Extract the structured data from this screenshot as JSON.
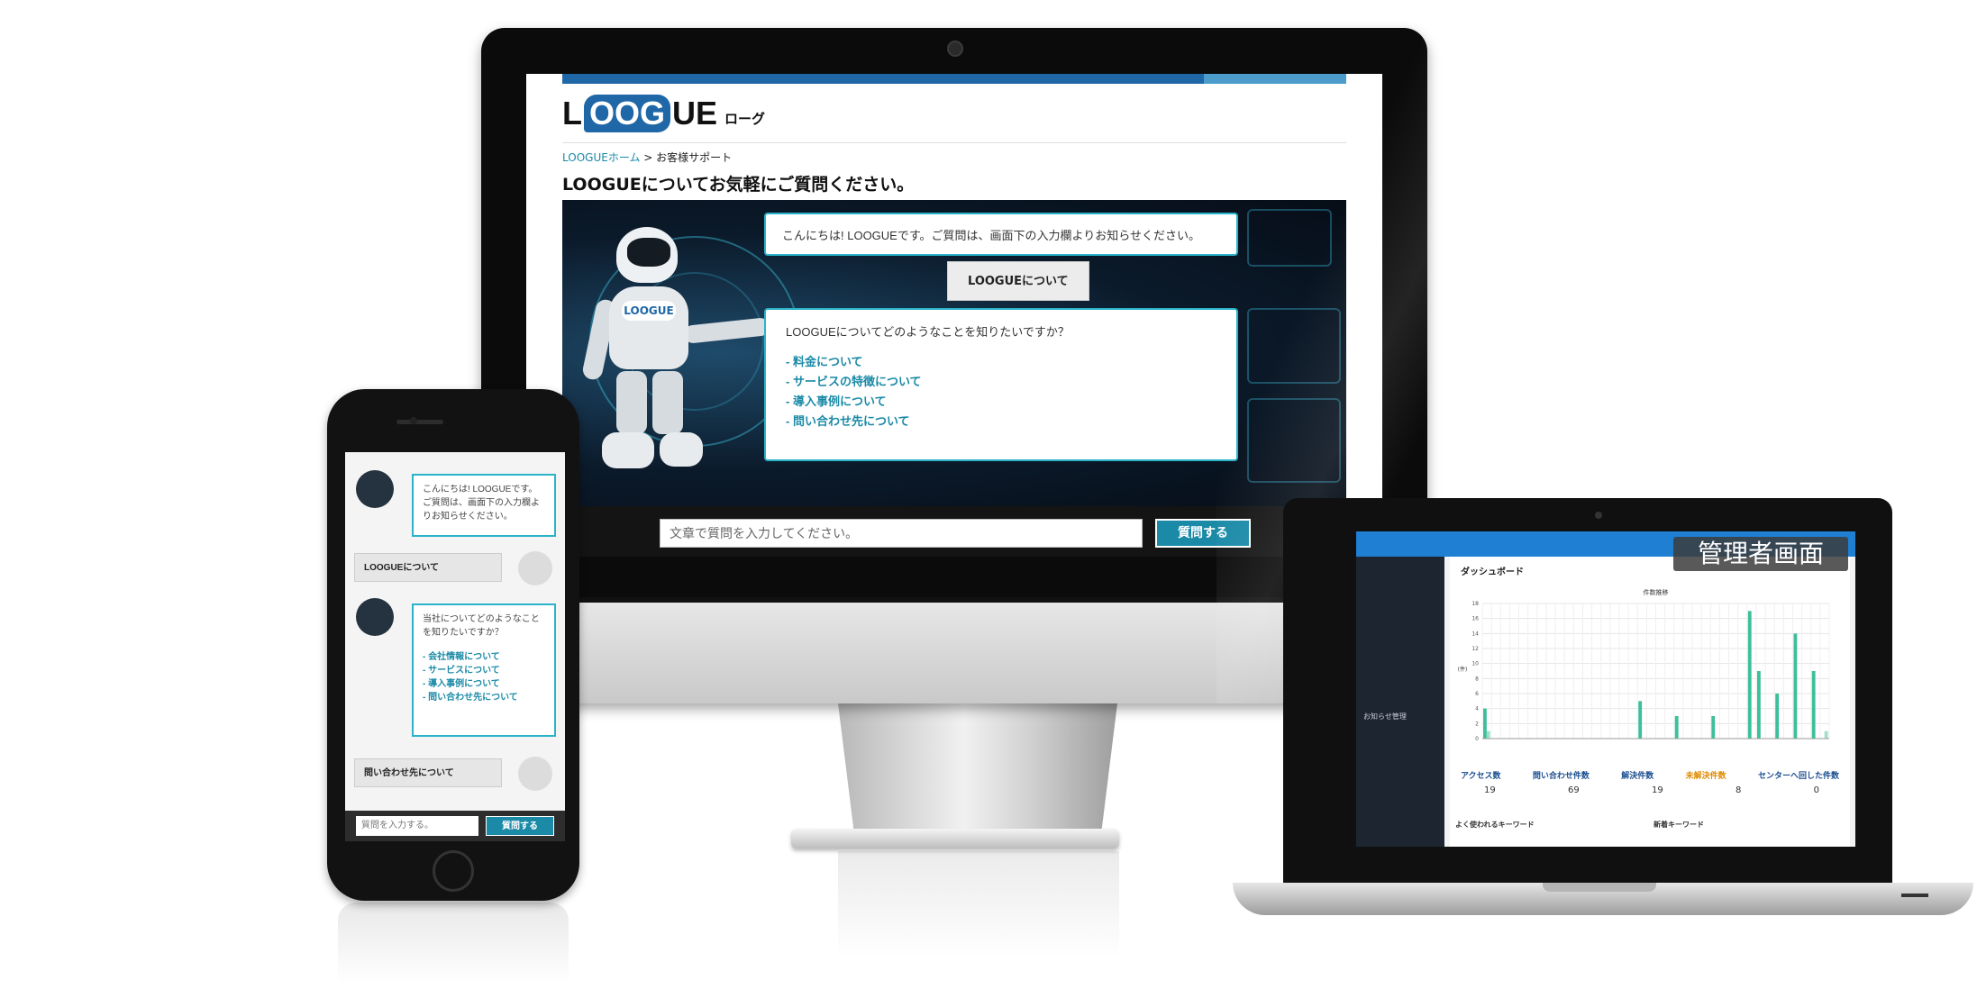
{
  "desktop": {
    "logo": {
      "prefix": "L",
      "highlight": "OOG",
      "suffix": "UE",
      "sub": "ローグ"
    },
    "breadcrumb": {
      "home": "LOOGUEホーム",
      "separator": ">",
      "current": "お客様サポート"
    },
    "page_title": "LOOGUEについてお気軽にご質問ください。",
    "robot_badge": "LOOGUE",
    "chat": {
      "bot_greeting": "こんにちは! LOOGUEです。ご質問は、画面下の入力欄よりお知らせください。",
      "user_message": "LOOGUEについて",
      "bot_question": "LOOGUEについてどのようなことを知りたいですか？",
      "options": [
        "- 料金について",
        "- サービスの特徴について",
        "- 導入事例について",
        "- 問い合わせ先について"
      ]
    },
    "input": {
      "placeholder": "文章で質問を入力してください。",
      "send_label": "質問する"
    }
  },
  "laptop": {
    "badge": "管理者画面",
    "panel_title": "ダッシュボード",
    "sidebar_item": "お知らせ管理",
    "chart_title": "件数推移",
    "stats": [
      {
        "label": "アクセス数",
        "value": "19",
        "color": "#1a4d8f"
      },
      {
        "label": "問い合わせ件数",
        "value": "69",
        "color": "#1a4d8f"
      },
      {
        "label": "解決件数",
        "value": "19",
        "color": "#1a4d8f"
      },
      {
        "label": "未解決件数",
        "value": "8",
        "color": "#e08a00"
      },
      {
        "label": "センターへ回した件数",
        "value": "0",
        "color": "#1a4d8f"
      }
    ],
    "sections": [
      "よく使われるキーワード",
      "新着キーワード"
    ]
  },
  "phone": {
    "bot_greeting": "こんにちは! LOOGUEです。ご質問は、画面下の入力欄よりお知らせください。",
    "user_message_1": "LOOGUEについて",
    "bot_question": "当社についてどのようなことを知りたいですか？",
    "options": [
      "- 会社情報について",
      "- サービスについて",
      "- 導入事例について",
      "- 問い合わせ先について"
    ],
    "user_message_2": "問い合わせ先について",
    "input": {
      "placeholder": "質問を入力する。",
      "send_label": "質問する"
    }
  },
  "chart_data": {
    "type": "bar",
    "title": "件数推移",
    "ylabel": "(件)",
    "ylim": [
      0,
      18
    ],
    "yticks": [
      0,
      2,
      4,
      6,
      8,
      10,
      12,
      14,
      16,
      18
    ],
    "series": [
      {
        "color": "#3dbf9a",
        "values": [
          4,
          0,
          0,
          0,
          0,
          0,
          0,
          0,
          0,
          0,
          0,
          0,
          0,
          0,
          0,
          0,
          0,
          5,
          0,
          0,
          0,
          3,
          0,
          0,
          0,
          3,
          0,
          0,
          0,
          17,
          9,
          0,
          6,
          0,
          14,
          0,
          9,
          0
        ]
      },
      {
        "color": "#9fe0cd",
        "values": [
          1,
          0,
          0,
          0,
          0,
          0,
          0,
          0,
          0,
          0,
          0,
          0,
          0,
          0,
          0,
          0,
          0,
          0,
          0,
          0,
          0,
          0,
          0,
          0,
          0,
          0,
          0,
          0,
          0,
          0,
          0,
          0,
          0,
          0,
          0,
          0,
          0,
          1
        ]
      }
    ]
  }
}
